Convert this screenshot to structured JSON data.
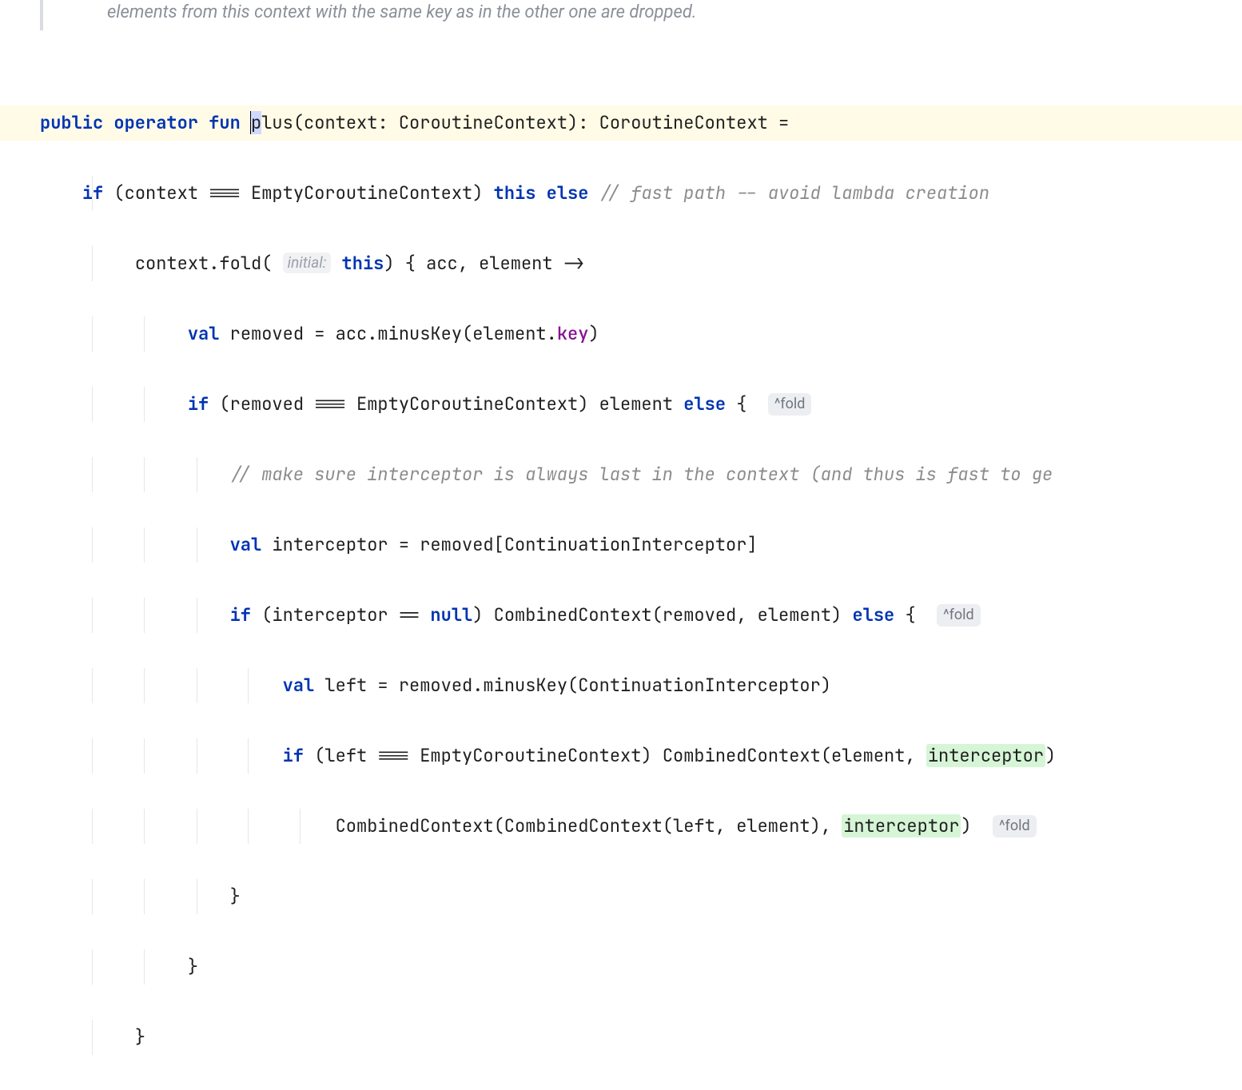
{
  "doc": {
    "fragment": "elements from this context with the same key as in the other one are dropped."
  },
  "code": {
    "l1": {
      "kw_public": "public",
      "kw_operator": "operator",
      "kw_fun": "fun",
      "fn_plus_p": "p",
      "fn_plus_lus": "lus",
      "sig_open": "(context: CoroutineContext): CoroutineContext ="
    },
    "l2": {
      "kw_if": "if",
      "cond": " (context === EmptyCoroutineContext) ",
      "kw_this": "this",
      "sp": " ",
      "kw_else": "else",
      "comment": " // fast path -- avoid lambda creation"
    },
    "l3": {
      "pre": "context.fold( ",
      "hint": "initial:",
      "sp": " ",
      "kw_this": "this",
      "post": ") { acc, element ->"
    },
    "l4": {
      "kw_val": "val",
      "mid": " removed = acc.minusKey(element.",
      "prop_key": "key",
      "close": ")"
    },
    "l5": {
      "kw_if": "if",
      "cond": " (removed === EmptyCoroutineContext) element ",
      "kw_else": "else",
      "brace": " { ",
      "hint": "^fold"
    },
    "l6": {
      "comment": "// make sure interceptor is always last in the context (and thus is fast to ge"
    },
    "l7": {
      "kw_val": "val",
      "rest": " interceptor = removed[ContinuationInterceptor]"
    },
    "l8": {
      "kw_if": "if",
      "pre": " (interceptor == ",
      "kw_null": "null",
      "mid": ") CombinedContext(removed, element) ",
      "kw_else": "else",
      "brace": " { ",
      "hint": "^fold"
    },
    "l9": {
      "kw_val": "val",
      "rest": " left = removed.minusKey(ContinuationInterceptor)"
    },
    "l10": {
      "kw_if": "if",
      "pre": " (left === EmptyCoroutineContext) CombinedContext(element, ",
      "usage": "interceptor",
      "close": ")"
    },
    "l11": {
      "pre": "CombinedContext(CombinedContext(left, element), ",
      "usage": "interceptor",
      "close": ") ",
      "hint": "^fold"
    },
    "l12": {
      "brace": "}"
    },
    "l13": {
      "brace": "}"
    },
    "l14": {
      "brace": "}"
    }
  },
  "guides": {
    "g1": 115,
    "g2": 180,
    "g3": 246,
    "g4": 310,
    "g5": 375,
    "g6": 440
  }
}
